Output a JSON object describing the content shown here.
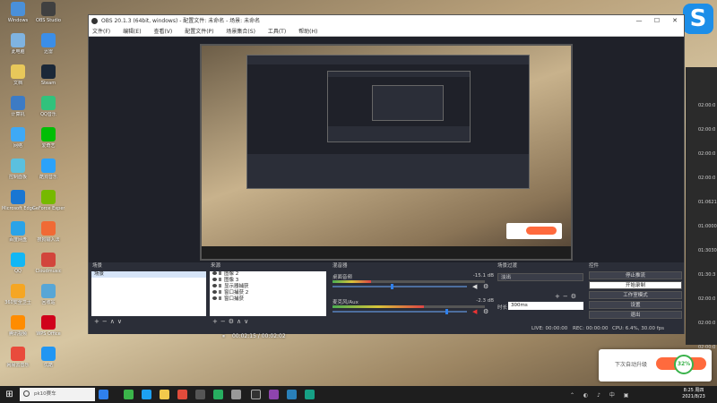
{
  "window": {
    "title": "OBS 20.1.3 (64bit, windows) - 配置文件: 未命名 - 场景: 未命名",
    "minimize": "—",
    "maximize": "☐",
    "close": "✕"
  },
  "menu": [
    "文件(F)",
    "编辑(E)",
    "查看(V)",
    "配置文件(P)",
    "场景集合(S)",
    "工具(T)",
    "帮助(H)"
  ],
  "docks": {
    "scenes": {
      "header": "场景",
      "items": [
        "场景"
      ]
    },
    "sources": {
      "header": "来源",
      "items": [
        "图像 2",
        "图像 3",
        "显示器捕获",
        "窗口捕获 2",
        "窗口捕获"
      ]
    },
    "mixer": {
      "header": "混音器",
      "channels": [
        {
          "name": "桌面音频",
          "db": "-15.1 dB",
          "level": 0.44
        },
        {
          "name": "麦克风/Aux",
          "db": "-2.3 dB",
          "level": 0.86
        }
      ]
    },
    "transitions": {
      "header": "场景过渡",
      "selected": "淡出",
      "duration_label": "时长",
      "duration": "300ms"
    },
    "controls": {
      "header": "控件",
      "buttons": [
        "停止推流",
        "开始录制",
        "工作室模式",
        "设置",
        "退出"
      ]
    }
  },
  "tools_glyphs": {
    "add": "+",
    "remove": "−",
    "up": "∧",
    "down": "∨",
    "gear": "⚙",
    "mute": "◀"
  },
  "status": {
    "live": "LIVE: 00:00:00",
    "rec": "REC: 00:00:00",
    "cpu": "CPU: 6.4%, 30.00 fps"
  },
  "playback": {
    "play": "⏸",
    "time": "00:02:15 / 00:02:02"
  },
  "right_panel_times": [
    "02:00:0",
    "02:00:0",
    "02:00:0",
    "02:00:0",
    "01:0621",
    "01:0000",
    "01:3030",
    "01:30:3",
    "02:00:0",
    "02:00:0",
    "02:00:0"
  ],
  "notification": {
    "text": "下次自动升级",
    "percent": "32%"
  },
  "taskbar": {
    "search": "pk10赛车",
    "clock_time": "8:25 周四",
    "clock_date": "2021/8/23"
  },
  "desktop_icons": [
    "Windows",
    "此电脑",
    "文档",
    "计算机",
    "网络",
    "控制面板",
    "Microsoft Edge",
    "百度网盘",
    "QQ",
    "360安全卫士",
    "腾讯视频",
    "网易云音乐",
    "OBS Studio",
    "迅雷",
    "Steam",
    "QQ音乐",
    "爱奇艺",
    "酷狗音乐",
    "GeForce Experience",
    "搜狗输入法",
    "Cloudmusic",
    "回收站",
    "WPS Office",
    "优酷"
  ],
  "colors": {
    "accent": "#2f80ed",
    "obs_bg": "#2b2e38",
    "notif_bar": "#ff6a3d"
  }
}
